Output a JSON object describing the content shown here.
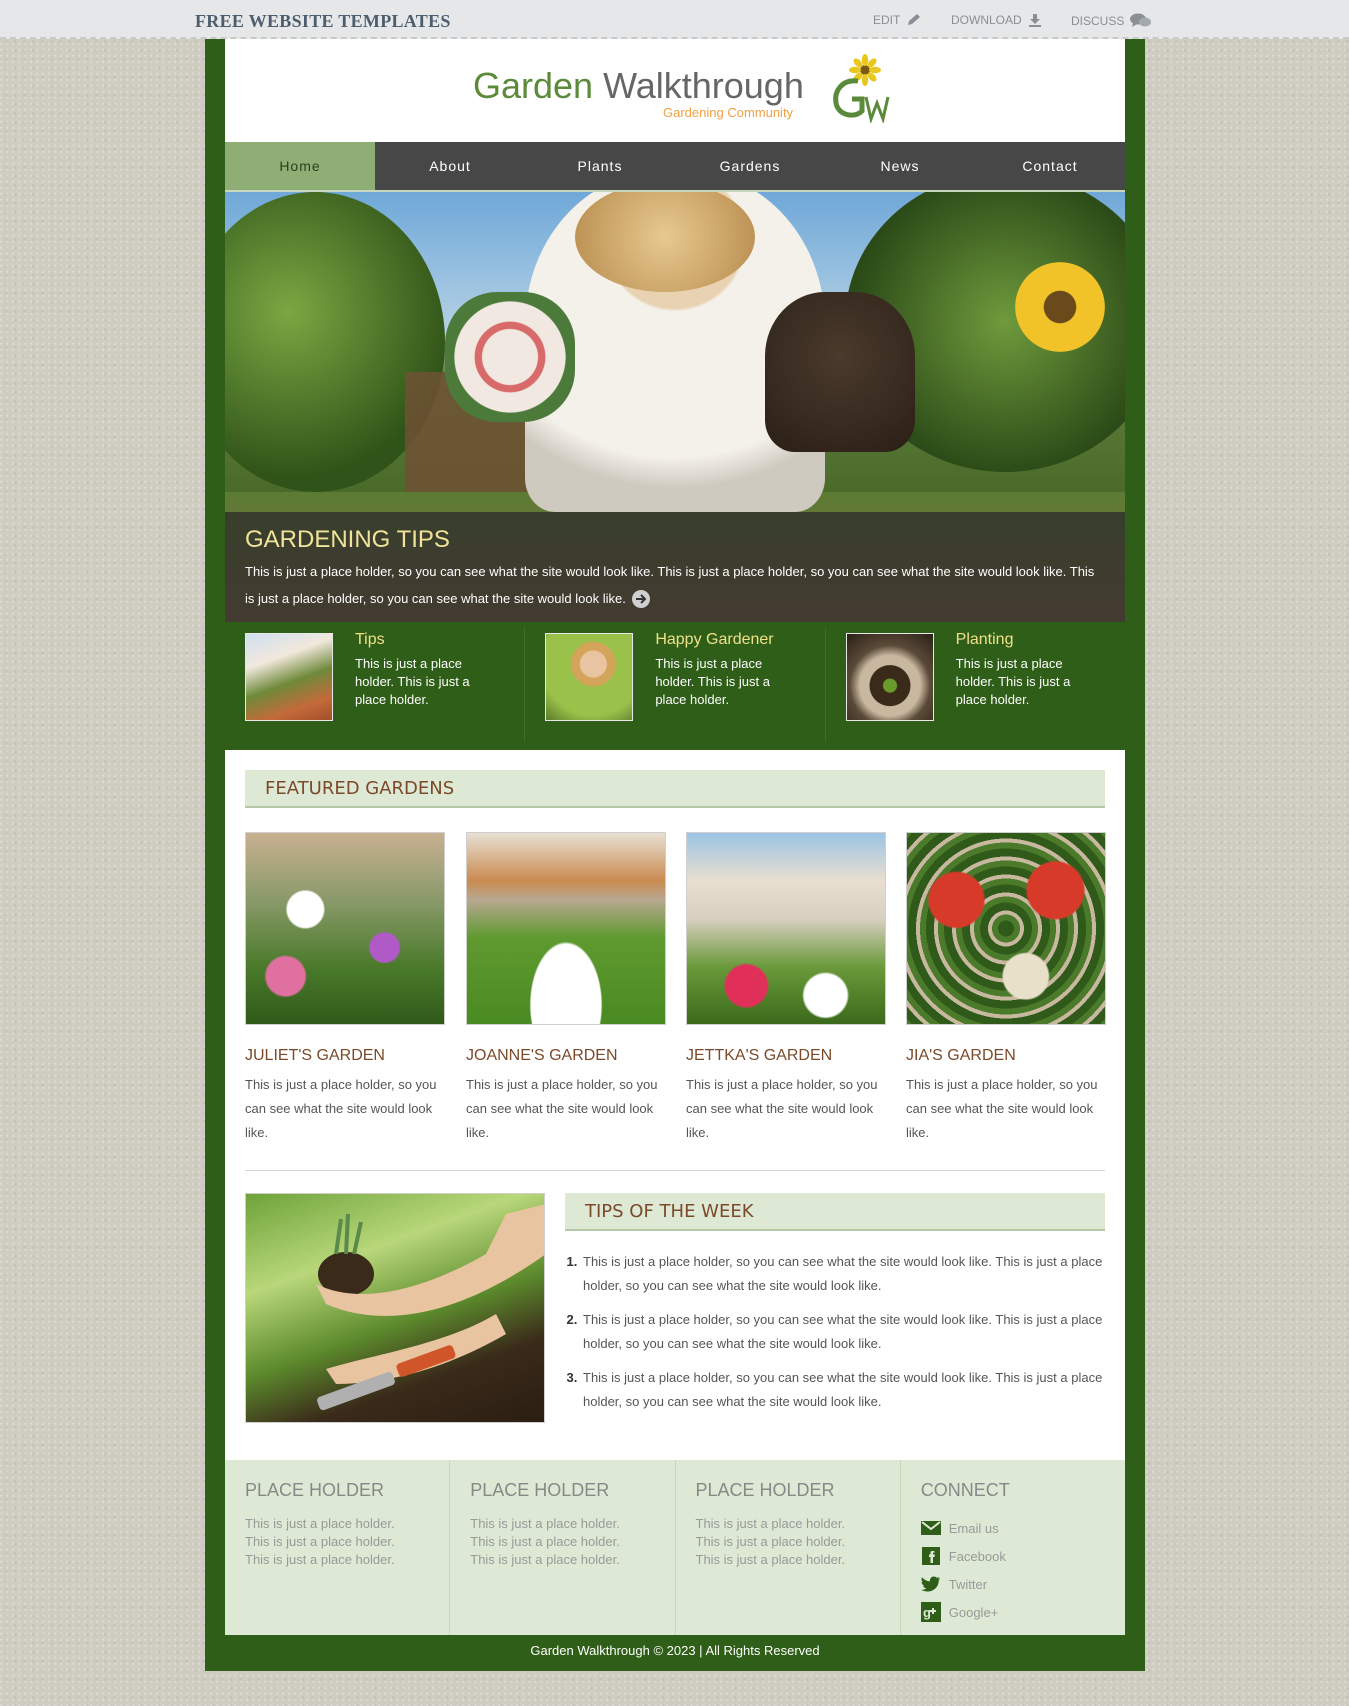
{
  "topbar": {
    "brand": "FREE WEBSITE TEMPLATES",
    "links": [
      {
        "label": "EDIT",
        "icon": "pencil-icon"
      },
      {
        "label": "DOWNLOAD",
        "icon": "download-icon"
      },
      {
        "label": "DISCUSS",
        "icon": "chat-icon"
      }
    ]
  },
  "header": {
    "title_part1": "Garden",
    "title_part2": " Walkthrough",
    "subtitle": "Gardening Community",
    "logo_letters": "GW"
  },
  "nav": {
    "items": [
      "Home",
      "About",
      "Plants",
      "Gardens",
      "News",
      "Contact"
    ],
    "active": "Home"
  },
  "hero": {
    "title": "GARDENING TIPS",
    "text": "This is just a place holder, so you can see what the site would look like. This is just a place holder, so you can see what the site would look like. This is just a place holder, so you can see what the site would look like."
  },
  "tips": [
    {
      "title": "Tips",
      "text": "This is just a place holder. This is just a place holder."
    },
    {
      "title": "Happy Gardener",
      "text": "This is just a place holder. This is just a place holder."
    },
    {
      "title": "Planting",
      "text": "This is just a place holder. This is just a place holder."
    }
  ],
  "featured": {
    "heading": "FEATURED GARDENS",
    "gardens": [
      {
        "title": "JULIET'S GARDEN",
        "text": "This is just a place holder, so you can see what the site would look like."
      },
      {
        "title": "JOANNE'S GARDEN",
        "text": "This is just a place holder, so you can see what the site would look like."
      },
      {
        "title": "JETTKA'S GARDEN",
        "text": "This is just a place holder, so you can see what the site would look like."
      },
      {
        "title": "JIA'S GARDEN",
        "text": "This is just a place holder, so you can see what the site would look like."
      }
    ]
  },
  "tips_of_week": {
    "heading": "TIPS OF THE WEEK",
    "items": [
      "This is just a place holder, so you can see what the site would look like. This is just a place holder, so you can see what the site would look like.",
      "This is just a place holder, so you can see what the site would look like. This is just a place holder, so you can see what the site would look like.",
      "This is just a place holder, so you can see what the site would look like. This is just a place holder, so you can see what the site would look like."
    ]
  },
  "footer": {
    "columns": [
      {
        "title": "PLACE HOLDER",
        "lines": [
          "This is just a place holder.",
          "This is just a place holder.",
          "This is just a place holder."
        ]
      },
      {
        "title": "PLACE HOLDER",
        "lines": [
          "This is just a place holder.",
          "This is just a place holder.",
          "This is just a place holder."
        ]
      },
      {
        "title": "PLACE HOLDER",
        "lines": [
          "This is just a place holder.",
          "This is just a place holder.",
          "This is just a place holder."
        ]
      }
    ],
    "connect": {
      "title": "CONNECT",
      "links": [
        {
          "label": "Email us",
          "icon": "email-icon"
        },
        {
          "label": "Facebook",
          "icon": "facebook-icon"
        },
        {
          "label": "Twitter",
          "icon": "twitter-icon"
        },
        {
          "label": "Google+",
          "icon": "google-plus-icon"
        }
      ]
    },
    "copyright": "Garden Walkthrough © 2023 | All Rights Reserved"
  },
  "colors": {
    "frame_green": "#2e5e17",
    "nav_bg": "#474747",
    "nav_active": "#8fae75",
    "heading_brown": "#7a4a2a",
    "accent_yellow": "#f0e08a",
    "section_bg": "#dde9d4"
  }
}
